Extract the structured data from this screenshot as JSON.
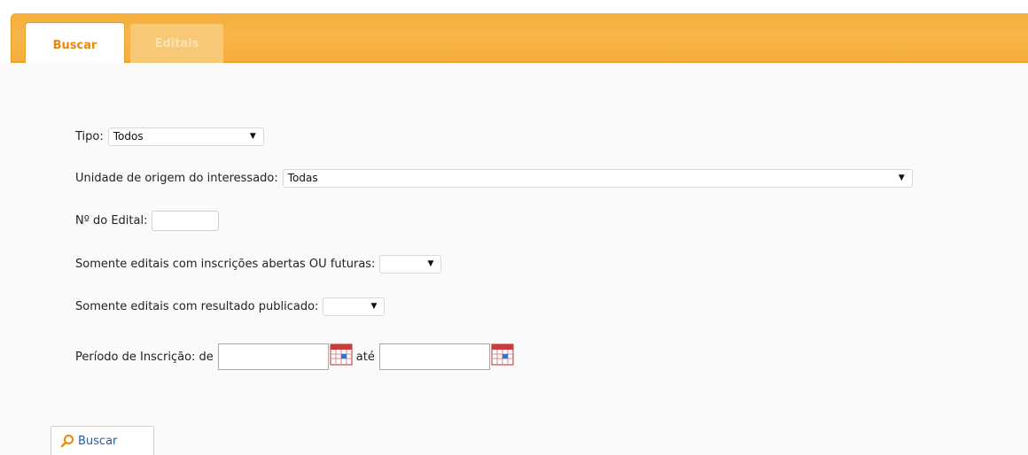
{
  "tabs": [
    {
      "label": "Buscar",
      "active": true
    },
    {
      "label": "Editais",
      "active": false
    }
  ],
  "form": {
    "tipo": {
      "label": "Tipo:",
      "value": "Todos"
    },
    "unidade": {
      "label": "Unidade de origem do interessado:",
      "value": "Todas"
    },
    "numero": {
      "label": "Nº do Edital:",
      "value": ""
    },
    "abertas": {
      "label": "Somente editais com inscrições abertas OU futuras:",
      "value": ""
    },
    "resultado": {
      "label": "Somente editais com resultado publicado:",
      "value": ""
    },
    "periodo": {
      "label": "Período de Inscrição: de",
      "ate_label": "até",
      "from": "",
      "to": ""
    }
  },
  "buttons": {
    "search_label": "Buscar"
  },
  "icons": {
    "calendar": "calendar-icon",
    "search": "search-icon"
  },
  "colors": {
    "tab_bar": "#f6ae3a",
    "tab_active_text": "#e88a06",
    "button_text": "#1e5fa8"
  }
}
